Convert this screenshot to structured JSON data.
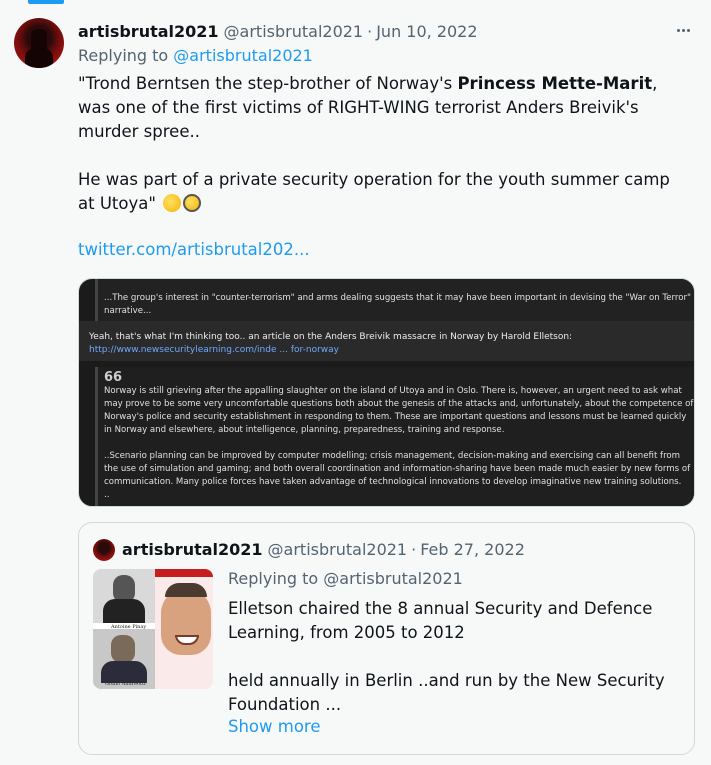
{
  "tweet": {
    "author_name": "artisbrutal2021",
    "author_handle": "@artisbrutal2021",
    "separator": "·",
    "date": "Jun 10, 2022",
    "replying_prefix": "Replying to ",
    "replying_to": "@artisbrutal2021",
    "text_part1": "\"Trond Berntsen the step-brother of Norway's ",
    "text_bold": "Princess Mette-Marit",
    "text_part2": ", was one of the first victims of RIGHT-WING terrorist Anders Breivik's murder spree..",
    "text_para2": "He was part of a private security operation for the youth summer camp at Utoya\"",
    "emojis": [
      "thinking-face-emoji",
      "face-with-monocle-emoji"
    ],
    "link": "twitter.com/artisbrutal202..."
  },
  "media": {
    "quote1": "...The group's interest in \"counter-terrorism\" and arms dealing suggests that it may have been important in devising the \"War on Terror\" narrative...",
    "band_text": "Yeah, that's what I'm thinking too.. an article on the Anders Breivik massacre in Norway by Harold Elletson:",
    "band_url": "http://www.newsecuritylearning.com/inde ... for-norway",
    "quote_mark": "66",
    "quote2_para1": "Norway is still grieving after the appalling slaughter on the island of Utoya and in Oslo. There is, however, an urgent need to ask what may prove to be some very uncomfortable questions both about the genesis of the attacks and, unfortunately, about the competence of Norway's police and security establishment in responding to them. These are important questions and lessons must be learned quickly in Norway and elsewhere, about intelligence, planning, preparedness, training and response.",
    "quote2_para2": "..Scenario planning can be improved by computer modelling; crisis management, decision-making and exercising can all benefit from the use of simulation and gaming; and both overall coordination and information-sharing have been made much easier by new forms of communication. Many police forces have taken advantage of technological innovations to develop imaginative new training solutions.",
    "quote2_tail": ".."
  },
  "quoted_tweet": {
    "author_name": "artisbrutal2021",
    "author_handle": "@artisbrutal2021",
    "separator": "·",
    "date": "Feb 27, 2022",
    "replying_text": "Replying to @artisbrutal2021",
    "text_para1": "Elletson chaired the 8 annual Security and Defence Learning, from 2005 to 2012",
    "text_para2": "held annually in Berlin ..and  run by the New Security Foundation ...",
    "show_more": "Show more",
    "thumb_captions": [
      "Antoine Pinay",
      "Giulio Andreotti"
    ]
  },
  "colors": {
    "accent": "#1d9bf0",
    "secondary_text": "#536471",
    "background": "#f7f9f9"
  }
}
